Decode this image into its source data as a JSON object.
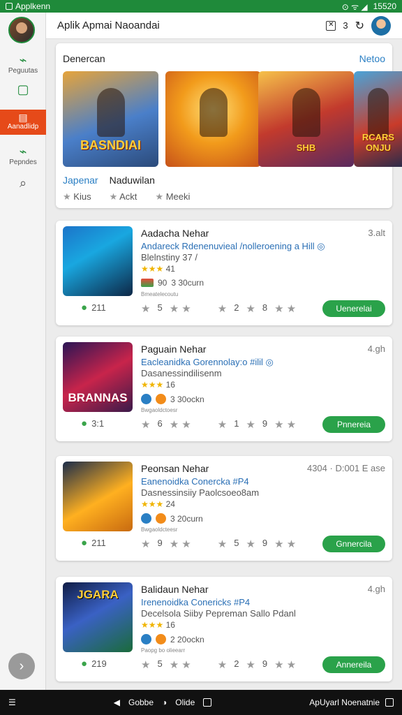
{
  "status": {
    "app": "Applkenn",
    "time": "15520"
  },
  "header": {
    "title": "Aplik Apmai Naoandai",
    "count": "3"
  },
  "sidebar": {
    "items": [
      {
        "label": "Peguutas"
      },
      {
        "label": "Aanadlidp"
      },
      {
        "label": "Pepndes"
      }
    ]
  },
  "featured": {
    "title": "Denercan",
    "link": "Netoo",
    "tiles": [
      "BASNDIAI",
      "",
      "SHB",
      "RCARS ONJU"
    ],
    "tab_a": "Japenar",
    "tab_b": "Naduwilan",
    "meta": [
      "Kius",
      "Ackt",
      "Meeki"
    ]
  },
  "apps": [
    {
      "name": "Aadacha Nehar",
      "meta": "3.alt",
      "dev": "Andareck Rdenenuvieal /nolleroening a Hill ◎",
      "sub": "Blelnstiny 37 /",
      "rating": "41",
      "dl1": "90",
      "dl2": "3 30curn",
      "note": "Bmeatelecoutu",
      "bottom": "211",
      "s1": "5",
      "s2": "2",
      "s3": "8",
      "cta": "Uenerelai",
      "icon": "",
      "icon_class": "i1"
    },
    {
      "name": "Paguain Nehar",
      "meta": "4.gh",
      "dev": "Eacleanidka Gorennolay:o #ilil ◎",
      "sub": "Dasanessindilisenm",
      "rating": "16",
      "dl1": "",
      "dl2": "3 30ockn",
      "note": "Bwgaoldctoesr",
      "bottom": "3:1",
      "s1": "6",
      "s2": "1",
      "s3": "9",
      "cta": "Pnnereia",
      "icon": "BRANNAS",
      "icon_class": "i2"
    },
    {
      "name": "Peonsan Nehar",
      "meta": "4304 · D:001 E ase",
      "dev": "Eanenoidka Conercka #P4",
      "sub": "Dasnessinsiiy Paolcsoeo8am",
      "rating": "24",
      "dl1": "",
      "dl2": "3 20curn",
      "note": "Bwgaoldcteesr",
      "bottom": "211",
      "s1": "9",
      "s2": "5",
      "s3": "9",
      "cta": "Gnnercila",
      "icon": "",
      "icon_class": "i3"
    },
    {
      "name": "Balidaun Nehar",
      "meta": "4.gh",
      "dev": "Irenenoidka Conericks #P4",
      "sub": "Decelsola Siiby Pepreman Sallo Pdanl",
      "rating": "16",
      "dl1": "",
      "dl2": "2 20ockn",
      "note": "Paopg bo olieearr",
      "bottom": "219",
      "s1": "5",
      "s2": "2",
      "s3": "9",
      "cta": "Annereila",
      "icon": "JGARA",
      "icon_class": "i4"
    }
  ],
  "nav": {
    "left": "Gobbe",
    "mid": "Olide",
    "right": "ApUyarl Noenatnie"
  }
}
